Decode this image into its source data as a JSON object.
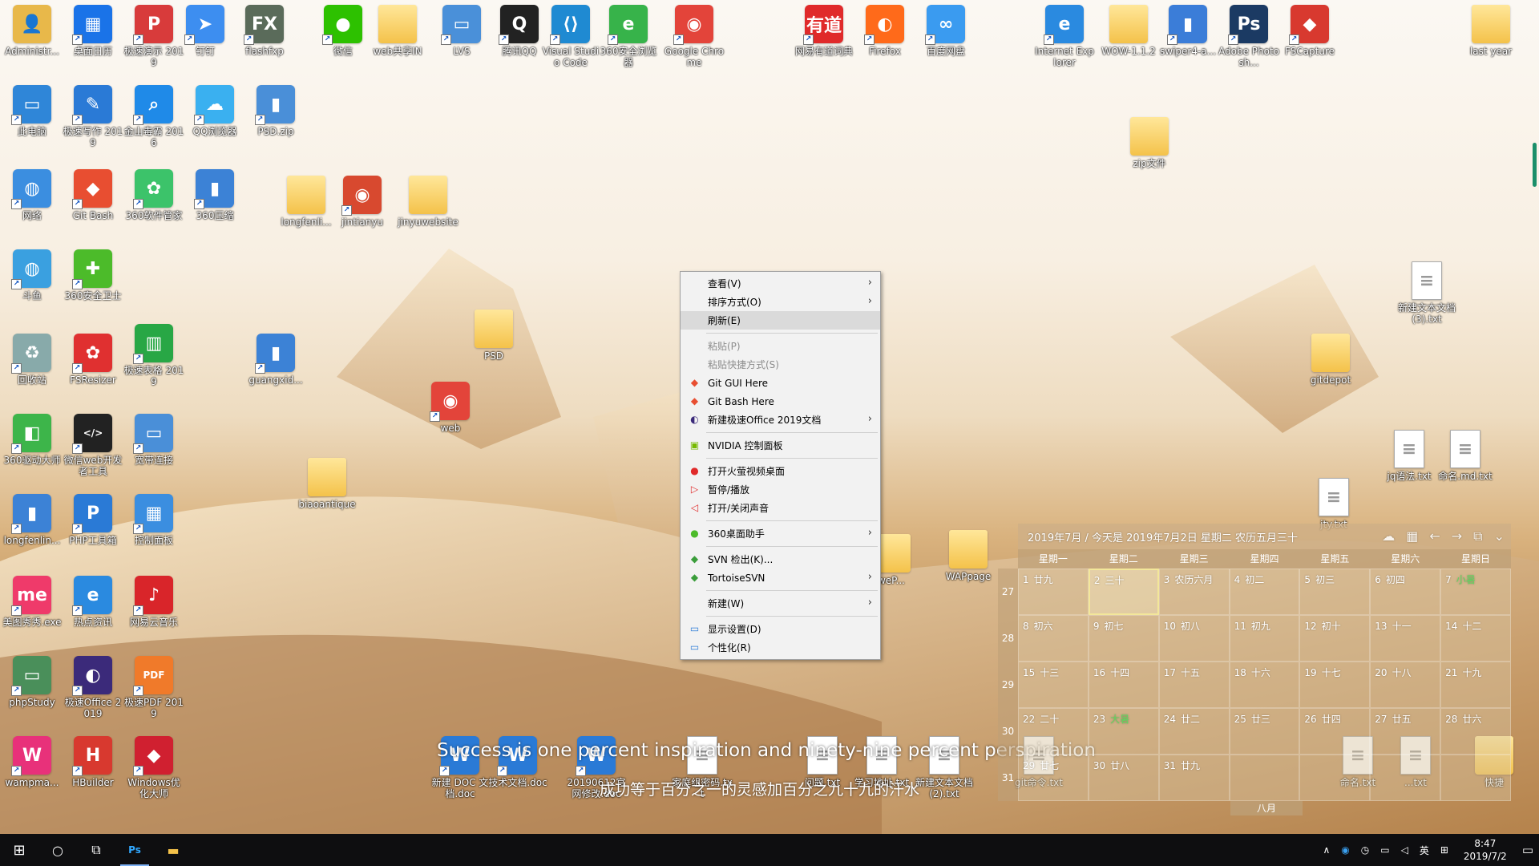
{
  "colors": {
    "taskbar": "#0e0e10",
    "menu_bg": "#f2f2f2",
    "menu_highlight": "#dadada",
    "calendar_today_border": "#f3e79a",
    "solar_term": "#5fd85f"
  },
  "desktop_icons": [
    {
      "label": "Administr...",
      "kind": "user",
      "glyph": "👤",
      "bg": "#e8b84a"
    },
    {
      "label": "桌面日历",
      "kind": "app",
      "glyph": "▦",
      "bg": "#1a73e8"
    },
    {
      "label": "极速演示 2019",
      "kind": "app",
      "glyph": "P",
      "bg": "#d83b3b"
    },
    {
      "label": "钉钉",
      "kind": "app",
      "glyph": "➤",
      "bg": "#3d8ef0"
    },
    {
      "label": "flashfxp",
      "kind": "app",
      "glyph": "FX",
      "bg": "#5a6b5a"
    },
    {
      "label": "微信",
      "kind": "app",
      "glyph": "●",
      "bg": "#2dc100"
    },
    {
      "label": "web共享IN",
      "kind": "folder",
      "glyph": "",
      "bg": ""
    },
    {
      "label": "LVS",
      "kind": "app",
      "glyph": "▭",
      "bg": "#4a90d9"
    },
    {
      "label": "腾讯QQ",
      "kind": "app",
      "glyph": "Q",
      "bg": "#222"
    },
    {
      "label": "Visual Studio Code",
      "kind": "app",
      "glyph": "⟨⟩",
      "bg": "#1f8ad2"
    },
    {
      "label": "360安全浏览器",
      "kind": "app",
      "glyph": "e",
      "bg": "#37b34a"
    },
    {
      "label": "Google Chrome",
      "kind": "app",
      "glyph": "◉",
      "bg": "#e3443a"
    },
    {
      "label": "网易有道词典",
      "kind": "app",
      "glyph": "有道",
      "bg": "#e02a2a"
    },
    {
      "label": "Firefox",
      "kind": "app",
      "glyph": "◐",
      "bg": "#ff6a1a"
    },
    {
      "label": "百度网盘",
      "kind": "app",
      "glyph": "∞",
      "bg": "#3a9bf0"
    },
    {
      "label": "Internet Explorer",
      "kind": "app",
      "glyph": "e",
      "bg": "#2a8ae0"
    },
    {
      "label": "WOW-1.1.2",
      "kind": "folder",
      "glyph": "",
      "bg": ""
    },
    {
      "label": "swiper4-a...",
      "kind": "app",
      "glyph": "▮",
      "bg": "#3b7dd8"
    },
    {
      "label": "Adobe Photosh...",
      "kind": "app",
      "glyph": "Ps",
      "bg": "#1b3a63"
    },
    {
      "label": "FSCapture",
      "kind": "app",
      "glyph": "◆",
      "bg": "#d8392f"
    },
    {
      "label": "last year",
      "kind": "folder",
      "glyph": "",
      "bg": ""
    },
    {
      "label": "此电脑",
      "kind": "app",
      "glyph": "▭",
      "bg": "#2f86d8"
    },
    {
      "label": "极速写作 2019",
      "kind": "app",
      "glyph": "✎",
      "bg": "#2a7ad6"
    },
    {
      "label": "金山毒霸 2016",
      "kind": "app",
      "glyph": "⌕",
      "bg": "#1f8ae8"
    },
    {
      "label": "QQ浏览器",
      "kind": "app",
      "glyph": "☁",
      "bg": "#3ab0f0"
    },
    {
      "label": "PSD.zip",
      "kind": "app",
      "glyph": "▮",
      "bg": "#4a8fd8"
    },
    {
      "label": "zip文件",
      "kind": "folder",
      "glyph": "",
      "bg": ""
    },
    {
      "label": "网络",
      "kind": "app",
      "glyph": "◍",
      "bg": "#3b8ee0"
    },
    {
      "label": "Git Bash",
      "kind": "app",
      "glyph": "◆",
      "bg": "#e84e31"
    },
    {
      "label": "360软件管家",
      "kind": "app",
      "glyph": "✿",
      "bg": "#3cc36a"
    },
    {
      "label": "360压缩",
      "kind": "app",
      "glyph": "▮",
      "bg": "#3c82d6"
    },
    {
      "label": "longfenli...",
      "kind": "folder",
      "glyph": "",
      "bg": ""
    },
    {
      "label": "jintianyu",
      "kind": "app",
      "glyph": "◉",
      "bg": "#d8492f"
    },
    {
      "label": "jinyuwebsite",
      "kind": "folder",
      "glyph": "",
      "bg": ""
    },
    {
      "label": "斗鱼",
      "kind": "app",
      "glyph": "◍",
      "bg": "#3aa0e0"
    },
    {
      "label": "360安全卫士",
      "kind": "app",
      "glyph": "✚",
      "bg": "#4cbb2a"
    },
    {
      "label": "新建文本文档 (3).txt",
      "kind": "doc",
      "glyph": "",
      "bg": ""
    },
    {
      "label": "PSD",
      "kind": "folder",
      "glyph": "",
      "bg": ""
    },
    {
      "label": "回收站",
      "kind": "app",
      "glyph": "♻",
      "bg": "#8aa"
    },
    {
      "label": "FSResizer",
      "kind": "app",
      "glyph": "✿",
      "bg": "#e03030"
    },
    {
      "label": "极速表格 2019",
      "kind": "app",
      "glyph": "▥",
      "bg": "#28a745"
    },
    {
      "label": "guangxid...",
      "kind": "app",
      "glyph": "▮",
      "bg": "#3c82d6"
    },
    {
      "label": "gitdepot",
      "kind": "folder",
      "glyph": "",
      "bg": ""
    },
    {
      "label": "web",
      "kind": "app",
      "glyph": "◉",
      "bg": "#e3443a"
    },
    {
      "label": "360驱动大师",
      "kind": "app",
      "glyph": "◧",
      "bg": "#3db54a"
    },
    {
      "label": "微信web开发者工具",
      "kind": "app",
      "glyph": "</>",
      "bg": "#222"
    },
    {
      "label": "宽带连接",
      "kind": "app",
      "glyph": "▭",
      "bg": "#4a8fd8"
    },
    {
      "label": "jq语法.txt",
      "kind": "doc",
      "glyph": "",
      "bg": ""
    },
    {
      "label": "命名.md.txt",
      "kind": "doc",
      "glyph": "",
      "bg": ""
    },
    {
      "label": "biaoantique",
      "kind": "folder",
      "glyph": "",
      "bg": ""
    },
    {
      "label": "jty.txt",
      "kind": "doc",
      "glyph": "",
      "bg": ""
    },
    {
      "label": "longfenlin...",
      "kind": "app",
      "glyph": "▮",
      "bg": "#3c82d6"
    },
    {
      "label": "PHP工具箱",
      "kind": "app",
      "glyph": "P",
      "bg": "#2a7ad6"
    },
    {
      "label": "控制面板",
      "kind": "app",
      "glyph": "▦",
      "bg": "#3b8ee0"
    },
    {
      "label": "WAPpage",
      "kind": "folder",
      "glyph": "",
      "bg": ""
    },
    {
      "label": "美图秀秀.exe",
      "kind": "app",
      "glyph": "me",
      "bg": "#ef3a6a"
    },
    {
      "label": "热点资讯",
      "kind": "app",
      "glyph": "e",
      "bg": "#2a8ae0"
    },
    {
      "label": "网易云音乐",
      "kind": "app",
      "glyph": "♪",
      "bg": "#d9252a"
    },
    {
      "label": "phpStudy",
      "kind": "app",
      "glyph": "▭",
      "bg": "#4a8f5a"
    },
    {
      "label": "极速Office 2019",
      "kind": "app",
      "glyph": "◐",
      "bg": "#3b2a7a"
    },
    {
      "label": "极速PDF 2019",
      "kind": "app",
      "glyph": "PDF",
      "bg": "#f07a2a"
    },
    {
      "label": "wampma...",
      "kind": "app",
      "glyph": "W",
      "bg": "#e8317a"
    },
    {
      "label": "HBuilder",
      "kind": "app",
      "glyph": "H",
      "bg": "#d8392f"
    },
    {
      "label": "Windows优化大师",
      "kind": "app",
      "glyph": "◆",
      "bg": "#d02030"
    },
    {
      "label": "新建 DOC 文档.doc",
      "kind": "app",
      "glyph": "W",
      "bg": "#2a7ad6"
    },
    {
      "label": "技术文档.doc",
      "kind": "app",
      "glyph": "W",
      "bg": "#2a7ad6"
    },
    {
      "label": "20190612官网修改.doc",
      "kind": "app",
      "glyph": "W",
      "bg": "#2a7ad6"
    },
    {
      "label": "家庭组密码.txt",
      "kind": "doc",
      "glyph": "",
      "bg": ""
    },
    {
      "label": "问题.txt",
      "kind": "doc",
      "glyph": "",
      "bg": ""
    },
    {
      "label": "学习地址.txt",
      "kind": "doc",
      "glyph": "",
      "bg": ""
    },
    {
      "label": "新建文本文档(2).txt",
      "kind": "doc",
      "glyph": "",
      "bg": ""
    },
    {
      "label": "git命令.txt",
      "kind": "doc",
      "glyph": "",
      "bg": ""
    },
    {
      "label": "命名.txt",
      "kind": "doc",
      "glyph": "",
      "bg": ""
    },
    {
      "label": "...txt",
      "kind": "doc",
      "glyph": "",
      "bg": ""
    },
    {
      "label": "快捷",
      "kind": "folder",
      "glyph": "",
      "bg": ""
    },
    {
      "label": "weP...",
      "kind": "folder",
      "glyph": "",
      "bg": ""
    }
  ],
  "wallpaper_text": {
    "line1": "Success is one percent inspiration and ninety-nine percent perspiration",
    "line2": "成功等于百分之一的灵感加百分之九十九的汗水"
  },
  "context_menu": {
    "items": [
      {
        "type": "item",
        "label": "查看(V)",
        "icon": "",
        "submenu": true,
        "disabled": false,
        "highlight": false
      },
      {
        "type": "item",
        "label": "排序方式(O)",
        "icon": "",
        "submenu": true,
        "disabled": false,
        "highlight": false
      },
      {
        "type": "item",
        "label": "刷新(E)",
        "icon": "",
        "submenu": false,
        "disabled": false,
        "highlight": true
      },
      {
        "type": "sep"
      },
      {
        "type": "item",
        "label": "粘贴(P)",
        "icon": "",
        "submenu": false,
        "disabled": true,
        "highlight": false
      },
      {
        "type": "item",
        "label": "粘贴快捷方式(S)",
        "icon": "",
        "submenu": false,
        "disabled": true,
        "highlight": false
      },
      {
        "type": "item",
        "label": "Git GUI Here",
        "icon": "◆",
        "icolor": "#e84e31",
        "submenu": false,
        "disabled": false,
        "highlight": false
      },
      {
        "type": "item",
        "label": "Git Bash Here",
        "icon": "◆",
        "icolor": "#e84e31",
        "submenu": false,
        "disabled": false,
        "highlight": false
      },
      {
        "type": "item",
        "label": "新建极速Office 2019文档",
        "icon": "◐",
        "icolor": "#3b2a7a",
        "submenu": true,
        "disabled": false,
        "highlight": false
      },
      {
        "type": "sep"
      },
      {
        "type": "item",
        "label": "NVIDIA 控制面板",
        "icon": "▣",
        "icolor": "#76b900",
        "submenu": false,
        "disabled": false,
        "highlight": false
      },
      {
        "type": "sep"
      },
      {
        "type": "item",
        "label": "打开火萤视频桌面",
        "icon": "●",
        "icolor": "#e02a2a",
        "submenu": false,
        "disabled": false,
        "highlight": false
      },
      {
        "type": "item",
        "label": "暂停/播放",
        "icon": "▷",
        "icolor": "#e02a2a",
        "submenu": false,
        "disabled": false,
        "highlight": false
      },
      {
        "type": "item",
        "label": "打开/关闭声音",
        "icon": "◁",
        "icolor": "#e02a2a",
        "submenu": false,
        "disabled": false,
        "highlight": false
      },
      {
        "type": "sep"
      },
      {
        "type": "item",
        "label": "360桌面助手",
        "icon": "●",
        "icolor": "#4cbb2a",
        "submenu": true,
        "disabled": false,
        "highlight": false
      },
      {
        "type": "sep"
      },
      {
        "type": "item",
        "label": "SVN 检出(K)...",
        "icon": "◆",
        "icolor": "#3a9d3a",
        "submenu": false,
        "disabled": false,
        "highlight": false
      },
      {
        "type": "item",
        "label": "TortoiseSVN",
        "icon": "◆",
        "icolor": "#3a9d3a",
        "submenu": true,
        "disabled": false,
        "highlight": false
      },
      {
        "type": "sep"
      },
      {
        "type": "item",
        "label": "新建(W)",
        "icon": "",
        "submenu": true,
        "disabled": false,
        "highlight": false
      },
      {
        "type": "sep"
      },
      {
        "type": "item",
        "label": "显示设置(D)",
        "icon": "▭",
        "icolor": "#2a7ad6",
        "submenu": false,
        "disabled": false,
        "highlight": false
      },
      {
        "type": "item",
        "label": "个性化(R)",
        "icon": "▭",
        "icolor": "#2a7ad6",
        "submenu": false,
        "disabled": false,
        "highlight": false
      }
    ]
  },
  "calendar": {
    "header": "2019年7月 / 今天是 2019年7月2日 星期二 农历五月三十",
    "tool_icons": [
      "cloud-icon",
      "calendar-icon",
      "prev-arrow-icon",
      "next-arrow-icon",
      "window-icon",
      "chevron-down-icon"
    ],
    "weekdays": [
      "星期一",
      "星期二",
      "星期三",
      "星期四",
      "星期五",
      "星期六",
      "星期日"
    ],
    "week_numbers": [
      "27",
      "28",
      "29",
      "30",
      "31"
    ],
    "days": [
      {
        "d": "1",
        "l": "廿九"
      },
      {
        "d": "2",
        "l": "三十",
        "today": true
      },
      {
        "d": "3",
        "l": "农历六月"
      },
      {
        "d": "4",
        "l": "初二"
      },
      {
        "d": "5",
        "l": "初三"
      },
      {
        "d": "6",
        "l": "初四"
      },
      {
        "d": "7",
        "l": "小暑",
        "term": true
      },
      {
        "d": "8",
        "l": "初六"
      },
      {
        "d": "9",
        "l": "初七"
      },
      {
        "d": "10",
        "l": "初八"
      },
      {
        "d": "11",
        "l": "初九"
      },
      {
        "d": "12",
        "l": "初十"
      },
      {
        "d": "13",
        "l": "十一"
      },
      {
        "d": "14",
        "l": "十二"
      },
      {
        "d": "15",
        "l": "十三"
      },
      {
        "d": "16",
        "l": "十四"
      },
      {
        "d": "17",
        "l": "十五"
      },
      {
        "d": "18",
        "l": "十六"
      },
      {
        "d": "19",
        "l": "十七"
      },
      {
        "d": "20",
        "l": "十八"
      },
      {
        "d": "21",
        "l": "十九"
      },
      {
        "d": "22",
        "l": "二十"
      },
      {
        "d": "23",
        "l": "大暑",
        "term": true
      },
      {
        "d": "24",
        "l": "廿二"
      },
      {
        "d": "25",
        "l": "廿三"
      },
      {
        "d": "26",
        "l": "廿四"
      },
      {
        "d": "27",
        "l": "廿五"
      },
      {
        "d": "28",
        "l": "廿六"
      },
      {
        "d": "29",
        "l": "廿七"
      },
      {
        "d": "30",
        "l": "廿八"
      },
      {
        "d": "31",
        "l": "廿九"
      },
      {
        "d": "",
        "l": ""
      },
      {
        "d": "",
        "l": ""
      },
      {
        "d": "",
        "l": ""
      },
      {
        "d": "",
        "l": ""
      }
    ],
    "next_month": "八月"
  },
  "taskbar": {
    "start_icon": "windows-logo-icon",
    "pinned": [
      {
        "name": "search-icon",
        "glyph": "○",
        "active": false
      },
      {
        "name": "task-view-icon",
        "glyph": "⧉",
        "active": false
      },
      {
        "name": "photoshop-icon",
        "glyph": "Ps",
        "active": true
      },
      {
        "name": "file-explorer-icon",
        "glyph": "▬",
        "active": false
      }
    ],
    "tray": {
      "chevron": "∧",
      "ime": "英",
      "time": "8:47",
      "date": "2019/7/2"
    }
  }
}
